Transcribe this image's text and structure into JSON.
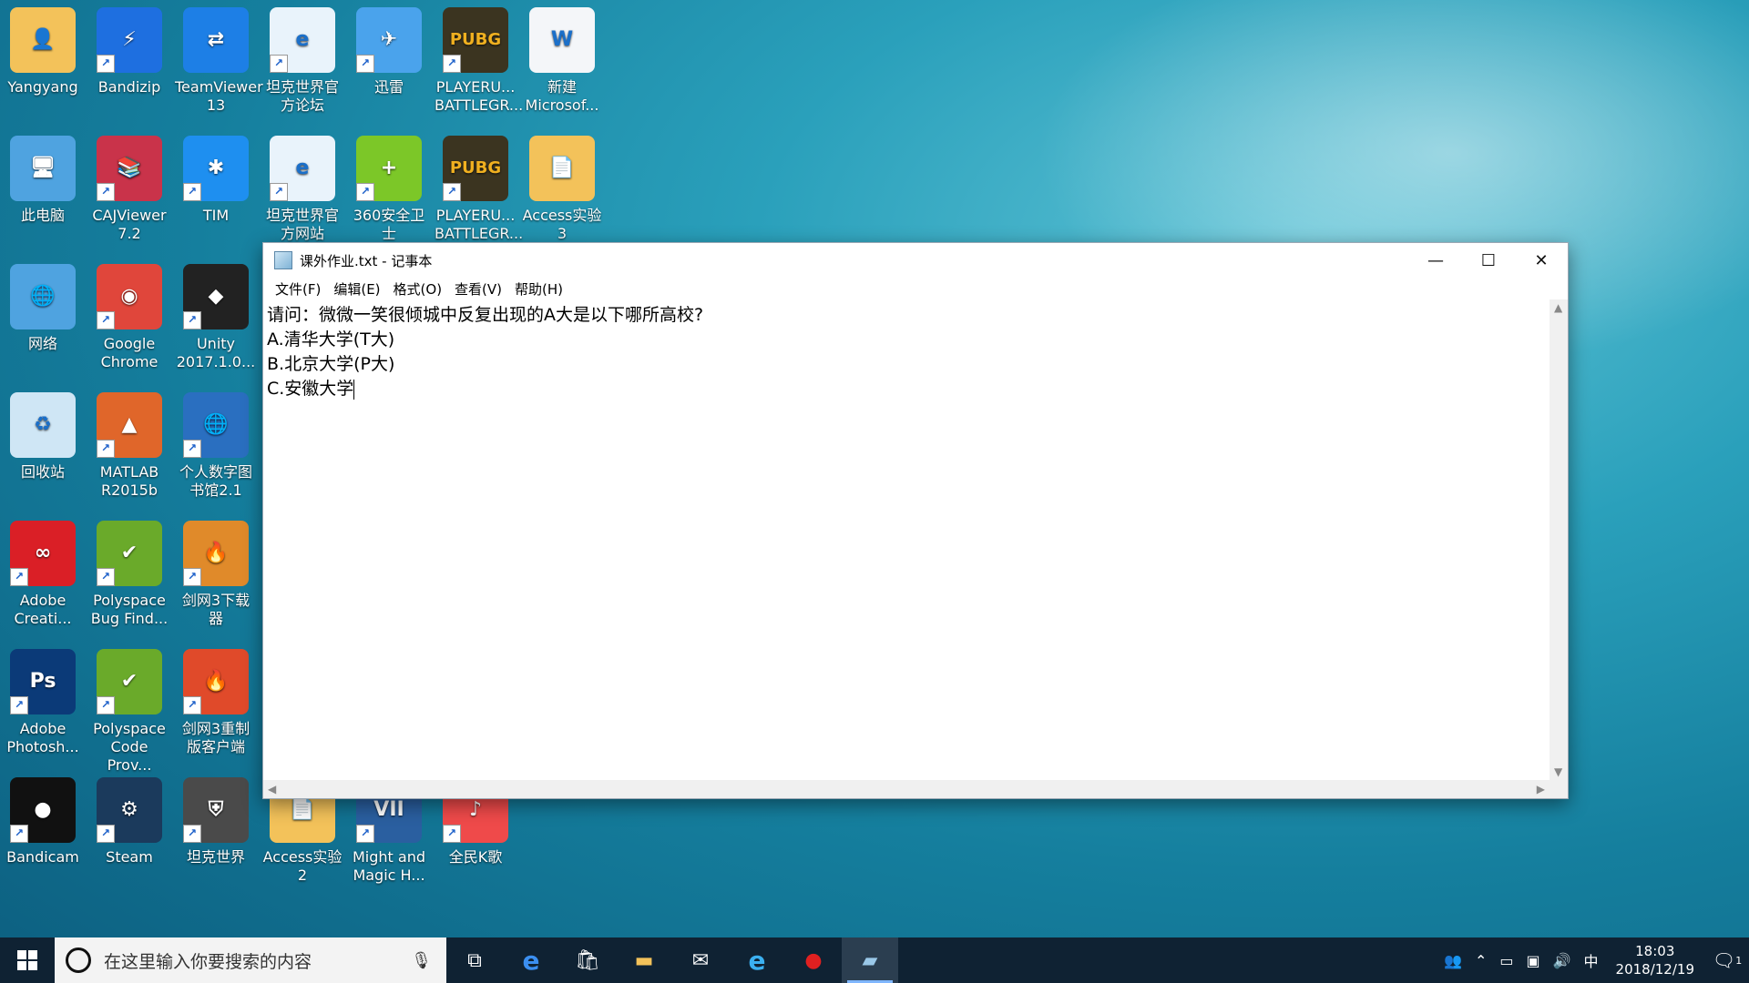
{
  "desktop_icons": [
    {
      "label": "Yangyang",
      "glyph": "👤",
      "color": "#f3c25a",
      "shortcut": false
    },
    {
      "label": "Bandizip",
      "glyph": "⚡",
      "color": "#1e6fe0",
      "shortcut": true
    },
    {
      "label": "TeamViewer 13",
      "glyph": "⇄",
      "color": "#1d7fe6",
      "shortcut": false
    },
    {
      "label": "坦克世界官方论坛",
      "glyph": "e",
      "color": "#e9f3fb",
      "shortcut": true
    },
    {
      "label": "迅雷",
      "glyph": "✈",
      "color": "#4aa3ec",
      "shortcut": true
    },
    {
      "label": "PLAYERU... BATTLEGR...",
      "glyph": "PUBG",
      "color": "#3b3420",
      "shortcut": true
    },
    {
      "label": "新建 Microsof...",
      "glyph": "W",
      "color": "#f4f6f9",
      "shortcut": false
    },
    {
      "label": "此电脑",
      "glyph": "🖥",
      "color": "#4fa3e0",
      "shortcut": false
    },
    {
      "label": "CAJViewer 7.2",
      "glyph": "📚",
      "color": "#c9334a",
      "shortcut": true
    },
    {
      "label": "TIM",
      "glyph": "✱",
      "color": "#1e8ff0",
      "shortcut": true
    },
    {
      "label": "坦克世界官方网站",
      "glyph": "e",
      "color": "#e9f3fb",
      "shortcut": true
    },
    {
      "label": "360安全卫士",
      "glyph": "+",
      "color": "#7cc728",
      "shortcut": true
    },
    {
      "label": "PLAYERU... BATTLEGR...",
      "glyph": "PUBG",
      "color": "#3b3420",
      "shortcut": true
    },
    {
      "label": "Access实验3",
      "glyph": "📄",
      "color": "#f3c25a",
      "shortcut": false
    },
    {
      "label": "网络",
      "glyph": "🌐",
      "color": "#4fa3e0",
      "shortcut": false
    },
    {
      "label": "Google Chrome",
      "glyph": "◉",
      "color": "#e0463b",
      "shortcut": true
    },
    {
      "label": "Unity 2017.1.0...",
      "glyph": "◆",
      "color": "#222222",
      "shortcut": true
    },
    {
      "label": "回收站",
      "glyph": "♻",
      "color": "#cfe6f5",
      "shortcut": false
    },
    {
      "label": "MATLAB R2015b",
      "glyph": "▲",
      "color": "#e0662a",
      "shortcut": true
    },
    {
      "label": "个人数字图书馆2.1",
      "glyph": "🌐",
      "color": "#2a6fc0",
      "shortcut": true
    },
    {
      "label": "Adobe Creati...",
      "glyph": "∞",
      "color": "#da1f26",
      "shortcut": true
    },
    {
      "label": "Polyspace Bug Find...",
      "glyph": "✔",
      "color": "#6aaa2a",
      "shortcut": true
    },
    {
      "label": "剑网3下载器",
      "glyph": "🔥",
      "color": "#e08a2a",
      "shortcut": true
    },
    {
      "label": "Adobe Photosh...",
      "glyph": "Ps",
      "color": "#0b3a78",
      "shortcut": true
    },
    {
      "label": "Polyspace Code Prov...",
      "glyph": "✔",
      "color": "#6aaa2a",
      "shortcut": true
    },
    {
      "label": "剑网3重制版客户端",
      "glyph": "🔥",
      "color": "#e04a2a",
      "shortcut": true
    },
    {
      "label": "Bandicam",
      "glyph": "●",
      "color": "#111111",
      "shortcut": true
    },
    {
      "label": "Steam",
      "glyph": "⚙",
      "color": "#1b3a5c",
      "shortcut": true
    },
    {
      "label": "坦克世界",
      "glyph": "⛨",
      "color": "#4a4a4a",
      "shortcut": true
    },
    {
      "label": "Access实验2",
      "glyph": "📄",
      "color": "#f3c25a",
      "shortcut": false
    },
    {
      "label": "Might and Magic H...",
      "glyph": "VII",
      "color": "#2a5fa0",
      "shortcut": true
    },
    {
      "label": "全民K歌",
      "glyph": "♪",
      "color": "#ef4a4a",
      "shortcut": true
    }
  ],
  "notepad": {
    "title": "课外作业.txt - 记事本",
    "menu": [
      "文件(F)",
      "编辑(E)",
      "格式(O)",
      "查看(V)",
      "帮助(H)"
    ],
    "lines": [
      "请问：微微一笑很倾城中反复出现的A大是以下哪所高校?",
      "A.清华大学(T大)",
      "B.北京大学(P大)",
      "C.安徽大学"
    ]
  },
  "taskbar": {
    "search_placeholder": "在这里输入你要搜索的内容",
    "ime": "中",
    "time": "18:03",
    "date": "2018/12/19",
    "notification_count": "1"
  }
}
